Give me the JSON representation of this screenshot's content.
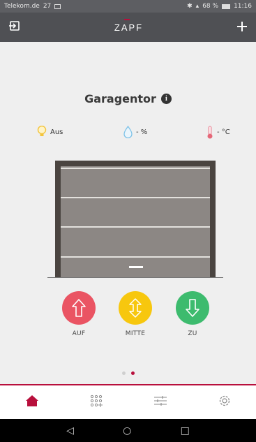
{
  "status_bar": {
    "carrier": "Telekom.de",
    "carrier_extra": "27",
    "signal": "68 %",
    "time": "11:16"
  },
  "app_bar": {
    "logo": "ZAPF",
    "logout_icon": "logout-icon",
    "add_icon": "plus-icon"
  },
  "device": {
    "title": "Garagentor",
    "info_icon": "i"
  },
  "sensors": {
    "light": {
      "icon": "bulb-icon",
      "value": "Aus"
    },
    "humidity": {
      "icon": "drop-icon",
      "value": "- %"
    },
    "temperature": {
      "icon": "thermometer-icon",
      "value": "- °C"
    }
  },
  "controls": [
    {
      "label": "AUF",
      "icon": "arrow-up-icon",
      "color": "#ea5463"
    },
    {
      "label": "MITTE",
      "icon": "arrow-updown-icon",
      "color": "#f7c70e"
    },
    {
      "label": "ZU",
      "icon": "arrow-down-icon",
      "color": "#3dbb6e"
    }
  ],
  "pager": {
    "total": 2,
    "active": 2
  },
  "tabbar": [
    {
      "icon": "home-icon",
      "active": true
    },
    {
      "icon": "grid-icon",
      "active": false
    },
    {
      "icon": "sliders-icon",
      "active": false
    },
    {
      "icon": "gear-icon",
      "active": false
    }
  ],
  "nav": {
    "back": "◁",
    "home": "○",
    "recent": "□"
  },
  "colors": {
    "accent": "#b80f3c",
    "app_bar": "#4f5054",
    "background": "#efefef"
  }
}
